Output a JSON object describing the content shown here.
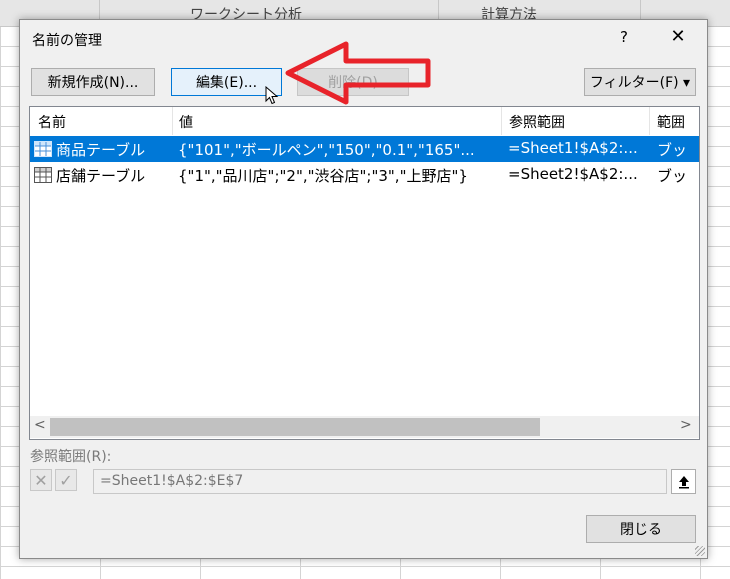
{
  "sheet": {
    "header_cols": [
      "ワークシート分析",
      "計算方法"
    ]
  },
  "dialog": {
    "title": "名前の管理",
    "help_label": "?",
    "close_label": "✕",
    "buttons": {
      "new": "新規作成(N)...",
      "edit": "編集(E)...",
      "delete": "削除(D)",
      "filter": "フィルター(F) ▾",
      "close": "閉じる"
    },
    "list": {
      "columns": [
        "名前",
        "値",
        "参照範囲",
        "範囲"
      ],
      "rows": [
        {
          "name": "商品テーブル",
          "value": "{\"101\",\"ボールペン\",\"150\",\"0.1\",\"165\"...",
          "ref": "=Sheet1!$A$2:...",
          "scope": "ブッ",
          "selected": true
        },
        {
          "name": "店舗テーブル",
          "value": "{\"1\",\"品川店\";\"2\",\"渋谷店\";\"3\",\"上野店\"}",
          "ref": "=Sheet2!$A$2:...",
          "scope": "ブッ",
          "selected": false
        }
      ]
    },
    "ref_label": "参照範囲(R):",
    "ref_value": "=Sheet1!$A$2:$E$7",
    "colors": {
      "selection": "#0078d7",
      "annotation_arrow": "#e8232a"
    }
  }
}
